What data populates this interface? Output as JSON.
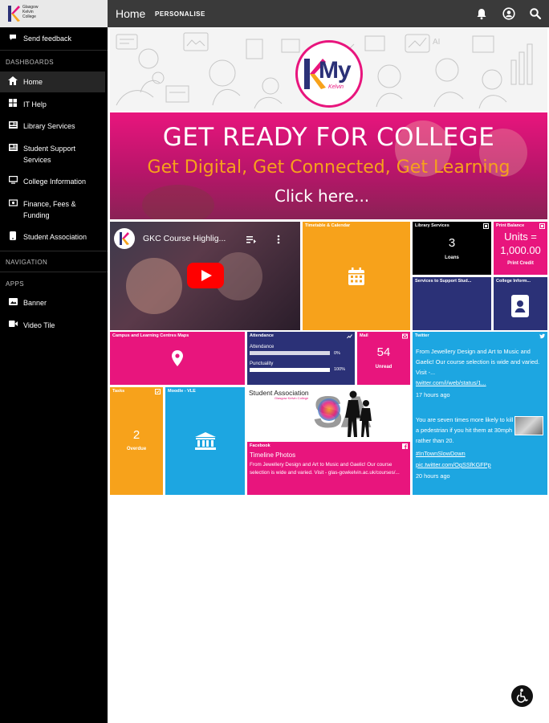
{
  "brand": {
    "college_name_lines": [
      "Glasgow",
      "Kelvin",
      "College"
    ],
    "colors": {
      "pink": "#e8157d",
      "orange": "#f7a21b",
      "navy": "#2b3177",
      "sky": "#1da6e1",
      "black": "#000000"
    }
  },
  "topbar": {
    "title": "Home",
    "personalise_label": "PERSONALISE",
    "icons": [
      "bell-icon",
      "account-circle-icon",
      "search-icon"
    ]
  },
  "sidebar": {
    "feedback_label": "Send feedback",
    "dashboards_heading": "DASHBOARDS",
    "dashboard_items": [
      {
        "label": "Home",
        "icon": "home-icon"
      },
      {
        "label": "IT Help",
        "icon": "windows-icon"
      },
      {
        "label": "Library Services",
        "icon": "news-icon"
      },
      {
        "label": "Student Support Services",
        "icon": "news-icon"
      },
      {
        "label": "College Information",
        "icon": "monitor-icon"
      },
      {
        "label": "Finance, Fees & Funding",
        "icon": "money-icon"
      },
      {
        "label": "Student Association",
        "icon": "phone-icon"
      }
    ],
    "navigation_heading": "NAVIGATION",
    "apps_heading": "APPS",
    "app_items": [
      {
        "label": "Banner",
        "icon": "image-icon"
      },
      {
        "label": "Video Tile",
        "icon": "video-icon"
      }
    ]
  },
  "hero": {
    "logo_my": "My",
    "logo_sub": "Kelvin"
  },
  "banner": {
    "line1": "GET READY FOR COLLEGE",
    "line2": "Get Digital, Get Connected, Get Learning",
    "line3": "Click here..."
  },
  "tiles": {
    "video": {
      "title": "GKC Course Highlig..."
    },
    "timetable": {
      "title": "Timetable & Calendar"
    },
    "library": {
      "title": "Library Services",
      "count": "3",
      "caption": "Loans"
    },
    "print": {
      "title": "Print Balance",
      "value": "Units = 1,000.00",
      "caption": "Print Credit"
    },
    "support": {
      "title": "Services to Support Stud..."
    },
    "college_info": {
      "title": "College Inform..."
    },
    "maps": {
      "title": "Campus and Learning Centres Maps"
    },
    "attendance": {
      "title": "Attendance",
      "rows": [
        {
          "label": "Attendance",
          "value": "0%",
          "fraction": 0.0
        },
        {
          "label": "Punctuality",
          "value": "100%",
          "fraction": 1.0
        }
      ]
    },
    "mail": {
      "title": "Mail",
      "count": "54",
      "caption": "Unread"
    },
    "twitter": {
      "title": "Twitter",
      "tweet1_text": "From Jewellery Design and Art to Music and Gaelic! Our course selection is wide and varied. Visit -...",
      "tweet1_link": "twitter.com/i/web/status/1...",
      "tweet1_time": "17 hours ago",
      "tweet2_text": "You are seven times more likely to kill a pedestrian if you hit them at 30mph rather than 20.",
      "tweet2_tag": "#InTownSlowDown",
      "tweet2_link": "pic.twitter.com/OgSSfKGFPp",
      "tweet2_time": "20 hours ago"
    },
    "tasks": {
      "title": "Tasks",
      "count": "2",
      "caption": "Overdue"
    },
    "moodle": {
      "title": "Moodle - VLE"
    },
    "student_assoc": {
      "title": "Student Association",
      "sub": "Glasgow Kelvin College",
      "letters": "SA"
    },
    "facebook": {
      "title": "Facebook",
      "heading": "Timeline Photos",
      "text": "From Jewellery Design and Art to Music and Gaelic! Our course selection is wide and varied. Visit - glas-gowkelvin.ac.uk/courses/..."
    }
  }
}
